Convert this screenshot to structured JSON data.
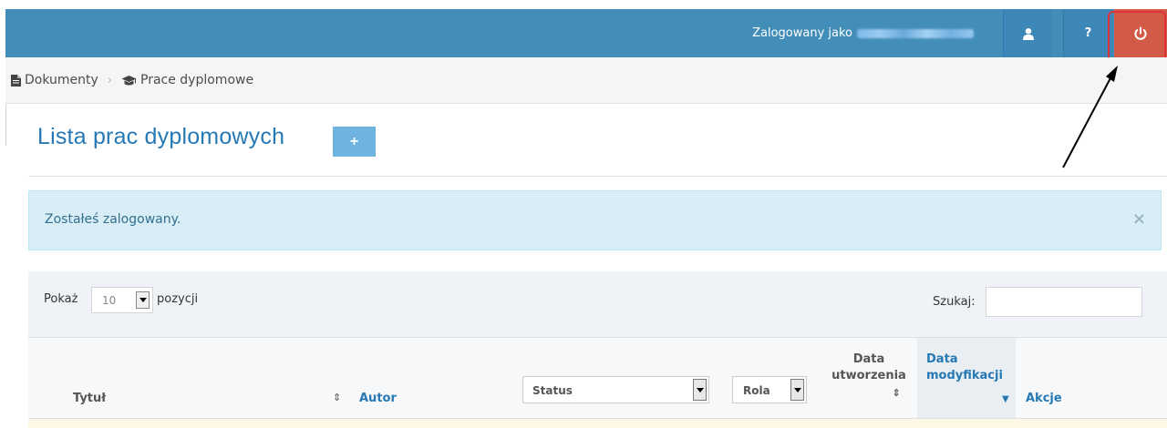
{
  "topbar": {
    "logged_in_label": "Zalogowany jako",
    "user_name": "Anna Jędrzejczak",
    "help_label": "?",
    "bg_color": "#438eb9",
    "power_color": "#d15b47"
  },
  "breadcrumb": {
    "items": [
      {
        "label": "Dokumenty",
        "icon": "file-icon"
      },
      {
        "label": "Prace dyplomowe",
        "icon": "graduation-cap-icon"
      }
    ],
    "separator": "›"
  },
  "page": {
    "title": "Lista prac dyplomowych",
    "add_label": "+"
  },
  "alert": {
    "message": "Zostałeś zalogowany.",
    "close": "×"
  },
  "table_controls": {
    "show_label": "Pokaż",
    "page_size": "10",
    "show_suffix": "pozycji",
    "search_label": "Szukaj:",
    "search_value": ""
  },
  "table": {
    "columns": {
      "title": "Tytuł",
      "title_sort": "⇕",
      "author": "Autor",
      "status_filter": "Status",
      "role_filter": "Rola",
      "created_line1": "Data",
      "created_line2": "utworzenia",
      "created_sort": "⇕",
      "modified_line1": "Data",
      "modified_line2": "modyfikacji",
      "modified_sort": "▼",
      "actions": "Akcje"
    }
  }
}
